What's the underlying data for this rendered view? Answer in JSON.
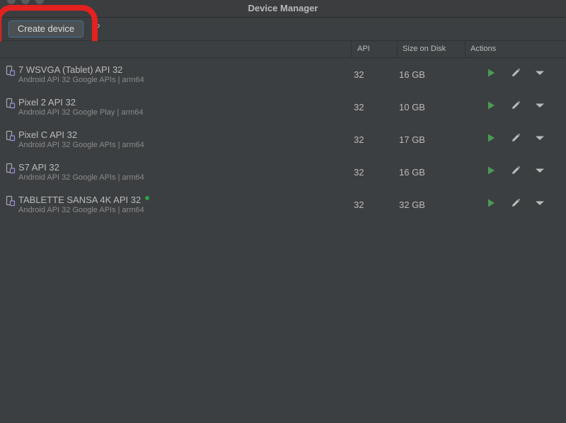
{
  "window": {
    "title": "Device Manager"
  },
  "toolbar": {
    "create_label": "Create device",
    "help_icon": "?"
  },
  "table": {
    "columns": [
      "",
      "API",
      "Size on Disk",
      "Actions"
    ],
    "rows": [
      {
        "name": "7  WSVGA (Tablet) API 32",
        "desc": "Android API 32 Google APIs | arm64",
        "api": "32",
        "size": "16 GB",
        "running": false
      },
      {
        "name": "Pixel 2 API 32",
        "desc": "Android API 32 Google Play | arm64",
        "api": "32",
        "size": "10 GB",
        "running": false
      },
      {
        "name": "Pixel C API 32",
        "desc": "Android API 32 Google APIs | arm64",
        "api": "32",
        "size": "17 GB",
        "running": false
      },
      {
        "name": "S7 API 32",
        "desc": "Android API 32 Google APIs | arm64",
        "api": "32",
        "size": "16 GB",
        "running": false
      },
      {
        "name": "TABLETTE SANSA 4K API 32",
        "desc": "Android API 32 Google APIs | arm64",
        "api": "32",
        "size": "32 GB",
        "running": true
      }
    ]
  },
  "icons": {
    "device": "device-icon",
    "play": "play-icon",
    "edit": "pencil-icon",
    "more": "chevron-down-icon"
  },
  "colors": {
    "background": "#3c3f41",
    "play_green": "#499c54",
    "highlight_red": "#e3211f",
    "running_dot": "#2ea043"
  }
}
